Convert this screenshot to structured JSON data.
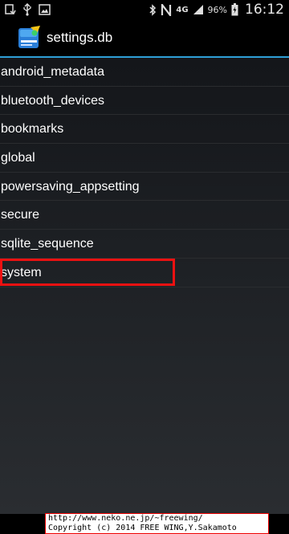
{
  "status_bar": {
    "battery_percent": "96%",
    "network_type": "4G",
    "time": "16:12",
    "icons_left": [
      "notification-icon",
      "usb-icon",
      "image-icon"
    ],
    "icons_right": [
      "bluetooth-icon",
      "nfc-icon",
      "network-4g-icon",
      "signal-icon",
      "battery-icon"
    ]
  },
  "app_bar": {
    "title": "settings.db",
    "icon": "database-app-icon",
    "accent_color": "#2e9fd6"
  },
  "tables": [
    {
      "name": "android_metadata"
    },
    {
      "name": "bluetooth_devices"
    },
    {
      "name": "bookmarks"
    },
    {
      "name": "global"
    },
    {
      "name": "powersaving_appsetting"
    },
    {
      "name": "secure"
    },
    {
      "name": "sqlite_sequence"
    },
    {
      "name": "system"
    }
  ],
  "highlight": {
    "row": "system",
    "color": "#ee1111"
  },
  "watermark": {
    "line1": "http://www.neko.ne.jp/~freewing/",
    "line2": "Copyright (c) 2014 FREE WING,Y.Sakamoto"
  }
}
